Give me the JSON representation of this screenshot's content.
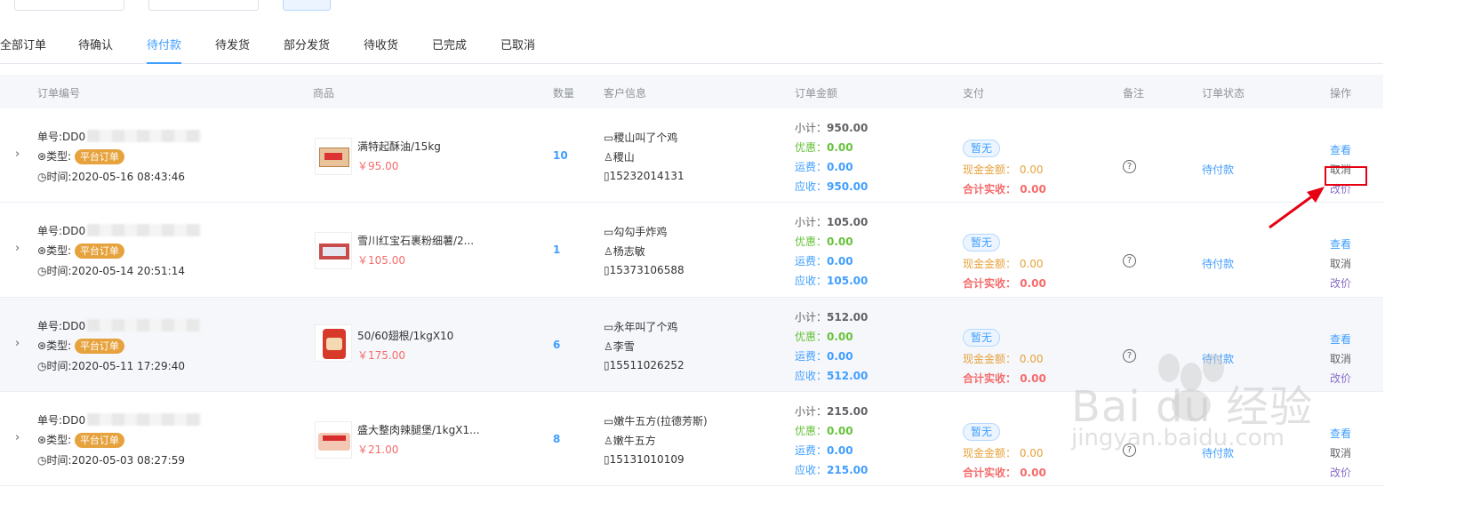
{
  "tabs": [
    {
      "label": "全部订单",
      "active": false
    },
    {
      "label": "待确认",
      "active": false
    },
    {
      "label": "待付款",
      "active": true
    },
    {
      "label": "待发货",
      "active": false
    },
    {
      "label": "部分发货",
      "active": false
    },
    {
      "label": "待收货",
      "active": false
    },
    {
      "label": "已完成",
      "active": false
    },
    {
      "label": "已取消",
      "active": false
    }
  ],
  "columns": {
    "order_no": "订单编号",
    "product": "商品",
    "qty": "数量",
    "customer": "客户信息",
    "amount": "订单金额",
    "payment": "支付",
    "remark": "备注",
    "status": "订单状态",
    "ops": "操作"
  },
  "labels": {
    "order_no_prefix": "单号:DD0",
    "type_prefix": "类型:",
    "time_prefix": "时间:",
    "subtotal": "小计：",
    "discount": "优惠：",
    "shipping": "运费：",
    "receivable": "应收：",
    "cash": "现金金额：",
    "total_received": "合计实收：",
    "view": "查看",
    "cancel": "取消",
    "change_price": "改价",
    "remark_icon": "?"
  },
  "orders": [
    {
      "order_no": "单号:DD0",
      "type_badge": "平台订单",
      "time": "时间:2020-05-16 08:43:46",
      "product_name": "满特起酥油/15kg",
      "product_price": "￥95.00",
      "qty": "10",
      "shop": "稷山叫了个鸡",
      "contact": "稷山",
      "phone": "15232014131",
      "subtotal": "950.00",
      "discount": "0.00",
      "shipping": "0.00",
      "receivable": "950.00",
      "pay_tag": "暂无",
      "cash": "0.00",
      "total_received": "0.00",
      "status": "待付款"
    },
    {
      "order_no": "单号:DD0",
      "type_badge": "平台订单",
      "time": "时间:2020-05-14 20:51:14",
      "product_name": "雪川红宝石裹粉细薯/2...",
      "product_price": "￥105.00",
      "qty": "1",
      "shop": "勾勾手炸鸡",
      "contact": "杨志敏",
      "phone": "15373106588",
      "subtotal": "105.00",
      "discount": "0.00",
      "shipping": "0.00",
      "receivable": "105.00",
      "pay_tag": "暂无",
      "cash": "0.00",
      "total_received": "0.00",
      "status": "待付款"
    },
    {
      "order_no": "单号:DD0",
      "type_badge": "平台订单",
      "time": "时间:2020-05-11 17:29:40",
      "product_name": "50/60翅根/1kgX10",
      "product_price": "￥175.00",
      "qty": "6",
      "shop": "永年叫了个鸡",
      "contact": "李雪",
      "phone": "15511026252",
      "subtotal": "512.00",
      "discount": "0.00",
      "shipping": "0.00",
      "receivable": "512.00",
      "pay_tag": "暂无",
      "cash": "0.00",
      "total_received": "0.00",
      "status": "待付款"
    },
    {
      "order_no": "单号:DD0",
      "type_badge": "平台订单",
      "time": "时间:2020-05-03 08:27:59",
      "product_name": "盛大整肉辣腿堡/1kgX1...",
      "product_price": "￥21.00",
      "qty": "8",
      "shop": "嫩牛五方(拉德芳斯)",
      "contact": "嫩牛五方",
      "phone": "15131010109",
      "subtotal": "215.00",
      "discount": "0.00",
      "shipping": "0.00",
      "receivable": "215.00",
      "pay_tag": "暂无",
      "cash": "0.00",
      "total_received": "0.00",
      "status": "待付款"
    }
  ],
  "watermark": {
    "main": "Bai du 经验",
    "sub": "jingyan.baidu.com"
  },
  "colors": {
    "accent": "#409eff",
    "badge": "#e6a23c",
    "highlight": "#e60012"
  }
}
